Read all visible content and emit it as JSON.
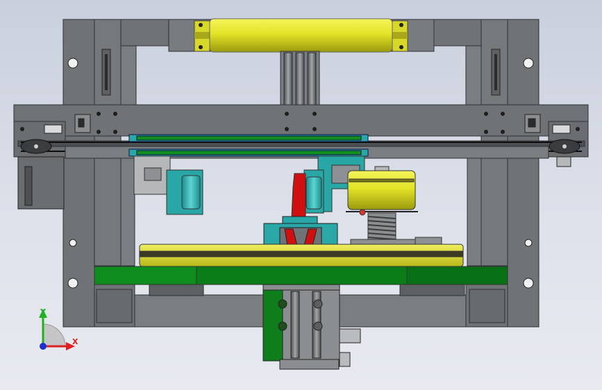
{
  "axis_triad": {
    "x_label": "X",
    "y_label": "Y",
    "x_color": "#e02020",
    "y_color": "#20b020",
    "z_color": "#1a30d0"
  },
  "palette": {
    "frame": "#6f7376",
    "frame_dark": "#3e4244",
    "roller": "#e3e328",
    "cyan_part": "#29a6a6",
    "green_plate": "#0e8d1e",
    "green_dark": "#066816",
    "red_part": "#d01010",
    "hole": "#f2f2f2",
    "bolt": "#222222"
  }
}
